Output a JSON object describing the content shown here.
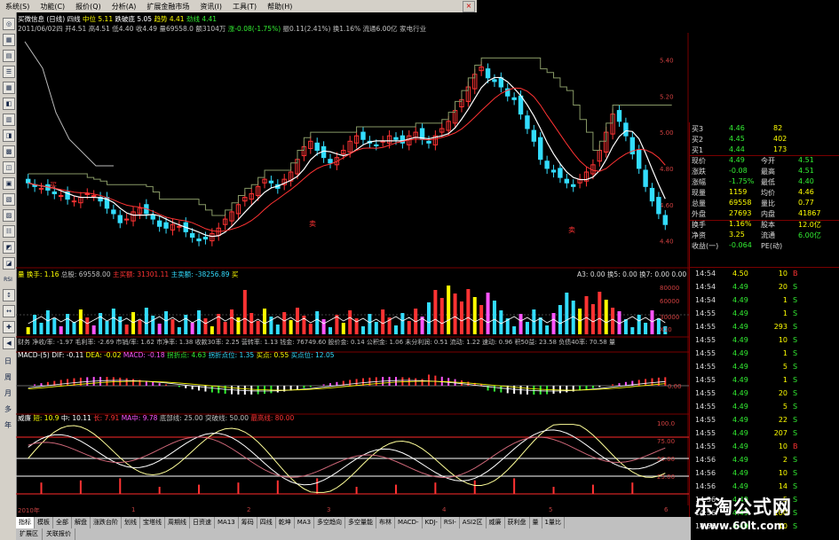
{
  "menu": [
    "系统(S)",
    "功能(C)",
    "报价(Q)",
    "分析(A)",
    "扩展金融市场",
    "资讯(I)",
    "工具(T)",
    "帮助(H)"
  ],
  "close_glyph": "×",
  "left_toolbar_chars": [
    "日",
    "周",
    "月",
    "多",
    "年"
  ],
  "left_toolbar_rsi": "RSI",
  "info1": {
    "a": "买微信息 (日线) 四线",
    "b": "中位 5.11",
    "c": "跌破底 5.05",
    "d": "趋势 4.41",
    "e": "劲线 4.41"
  },
  "info2": {
    "a": "2011/06/02四 开4.51 高4.51 低4.40 收4.49 量69558.0 额3104万",
    "b": "涨-0.08(-1.75%)",
    "c": "振0.11(2.41%) 换1.16% 流通6.00亿 家电行业"
  },
  "vol_info": {
    "a": "量 换手: 1.16",
    "b": "总股: 69558.00",
    "c": "主买额: 31301.11",
    "d": "主卖额: -38256.89",
    "e": "买",
    "f": "A3: 0.00 换5: 0.00 换7: 0.00 0.00"
  },
  "fin_info": "财务 净收/率: -1.97 毛利率: -2.69 市销/率: 1.62 市净率: 1.38 收款30率: 2.25 营转率: 1.13 钱金: 76749.60 股价金: 0.14 公积金: 1.06 未分利润: 0.51 流动: 1.22 速动: 0.96 积50益: 23.58 负债40率: 70.58 量",
  "macd_info": {
    "a": "MACD-(5)",
    "b": "DIF: -0.11",
    "c": "DEA: -0.02",
    "d": "MACD: -0.18",
    "e": "拐折点: 4.63",
    "f": "拐折点位: 1.35",
    "g": "买点: 0.55",
    "h": "买点位: 12.05"
  },
  "kdj_info": {
    "a": "威廉",
    "b": "短: 10.9",
    "c": "中: 10.11",
    "d": "长: 7.91",
    "e": "MA中: 9.78",
    "f": "底部线: 25.00",
    "g": "突破线: 50.00",
    "h": "最高线: 80.00"
  },
  "price_axis": [
    "5.40",
    "5.20",
    "5.00",
    "4.80",
    "4.60",
    "4.40"
  ],
  "vol_axis": [
    "80000",
    "60000",
    "30000",
    "X10"
  ],
  "macd_axis": [
    "0.00"
  ],
  "kdj_axis": [
    "100.0",
    "75.00",
    "50.00",
    "25.00"
  ],
  "quote": [
    {
      "l": "买3",
      "v": "4.46",
      "n": "82"
    },
    {
      "l": "买2",
      "v": "4.45",
      "n": "402"
    },
    {
      "l": "买1",
      "v": "4.44",
      "n": "173"
    },
    {
      "l": "现价",
      "v": "4.49",
      "l2": "今开",
      "v2": "4.51"
    },
    {
      "l": "涨跌",
      "v": "-0.08",
      "l2": "最高",
      "v2": "4.51"
    },
    {
      "l": "涨幅",
      "v": "-1.75%",
      "l2": "最低",
      "v2": "4.40"
    },
    {
      "l": "现量",
      "v": "1159",
      "l2": "均价",
      "v2": "4.46"
    },
    {
      "l": "总量",
      "v": "69558",
      "l2": "量比",
      "v2": "0.77"
    },
    {
      "l": "外盘",
      "v": "27693",
      "l2": "内盘",
      "v2": "41867"
    },
    {
      "l": "换手",
      "v": "1.16%",
      "l2": "股本",
      "v2": "12.0亿"
    },
    {
      "l": "净资",
      "v": "3.25",
      "l2": "流通",
      "v2": "6.00亿"
    },
    {
      "l": "收益(一)",
      "v": "-0.064",
      "l2": "PE(动)",
      "v2": ""
    }
  ],
  "ticks": [
    {
      "t": "14:54",
      "p": "4.50",
      "v": "10",
      "s": "B"
    },
    {
      "t": "14:54",
      "p": "4.49",
      "v": "20",
      "s": "S"
    },
    {
      "t": "14:54",
      "p": "4.49",
      "v": "1",
      "s": "S"
    },
    {
      "t": "14:55",
      "p": "4.49",
      "v": "1",
      "s": "S"
    },
    {
      "t": "14:55",
      "p": "4.49",
      "v": "293",
      "s": "S"
    },
    {
      "t": "14:55",
      "p": "4.49",
      "v": "10",
      "s": "S"
    },
    {
      "t": "14:55",
      "p": "4.49",
      "v": "1",
      "s": "S"
    },
    {
      "t": "14:55",
      "p": "4.49",
      "v": "5",
      "s": "S"
    },
    {
      "t": "14:55",
      "p": "4.49",
      "v": "1",
      "s": "S"
    },
    {
      "t": "14:55",
      "p": "4.49",
      "v": "20",
      "s": "S"
    },
    {
      "t": "14:55",
      "p": "4.49",
      "v": "5",
      "s": "S"
    },
    {
      "t": "14:55",
      "p": "4.49",
      "v": "22",
      "s": "S"
    },
    {
      "t": "14:55",
      "p": "4.49",
      "v": "207",
      "s": "S"
    },
    {
      "t": "14:55",
      "p": "4.49",
      "v": "10",
      "s": "B"
    },
    {
      "t": "14:56",
      "p": "4.49",
      "v": "2",
      "s": "S"
    },
    {
      "t": "14:56",
      "p": "4.49",
      "v": "10",
      "s": "S"
    },
    {
      "t": "14:56",
      "p": "4.49",
      "v": "14",
      "s": "S"
    },
    {
      "t": "14:56",
      "p": "4.49",
      "v": "5",
      "s": "S"
    },
    {
      "t": "14:56",
      "p": "4.49",
      "v": "100",
      "s": "S"
    },
    {
      "t": "14:56",
      "p": "4.49",
      "v": "10",
      "s": "S"
    }
  ],
  "time_scale": [
    "2010年",
    "1",
    "2",
    "3",
    "4",
    "5",
    "6"
  ],
  "tabs": [
    "指标",
    "模板",
    "全部",
    "解盘",
    "涨跌台阶",
    "划线",
    "宝塔线",
    "周期线",
    "日资速",
    "MA13",
    "筹码",
    "四线",
    "乾坤",
    "MA3",
    "多空趋向",
    "多空量能",
    "布林",
    "MACD-",
    "KDJ-",
    "RSI-",
    "ASI2区",
    "威廉",
    "获利盘",
    "量",
    "1量比"
  ],
  "active_tab": 0,
  "subtabs": [
    "扩展区",
    "关联报价"
  ],
  "chart_labels": {
    "buy": "买",
    "sell": "卖",
    "sell2": "卖"
  },
  "watermark": {
    "title": "乐淘公式网",
    "url": "www.60lt.com"
  },
  "colors": {
    "up": "#ff3333",
    "down": "#33ddff",
    "ma1": "#ffffff",
    "ma2": "#ffff00",
    "ma3": "#33ee33",
    "magenta": "#ff55ff",
    "frame": "#7a0000"
  },
  "chart_data": {
    "type": "candlestick",
    "price": {
      "ylim": [
        4.3,
        5.5
      ],
      "closes": [
        4.72,
        4.7,
        4.69,
        4.68,
        4.66,
        4.65,
        4.63,
        4.62,
        4.64,
        4.66,
        4.65,
        4.62,
        4.58,
        4.55,
        4.5,
        4.52,
        4.56,
        4.58,
        4.55,
        4.52,
        4.48,
        4.47,
        4.49,
        4.48,
        4.45,
        4.42,
        4.4,
        4.41,
        4.44,
        4.47,
        4.52,
        4.56,
        4.6,
        4.64,
        4.66,
        4.7,
        4.74,
        4.72,
        4.69,
        4.74,
        4.78,
        4.85,
        4.92,
        4.95,
        4.9,
        4.86,
        4.83,
        4.86,
        4.9,
        4.95,
        4.98,
        4.96,
        4.94,
        4.93,
        4.95,
        4.98,
        4.96,
        4.94,
        4.98,
        5.0,
        4.96,
        4.94,
        4.98,
        5.02,
        5.06,
        5.12,
        5.18,
        5.25,
        5.32,
        5.36,
        5.3,
        5.28,
        5.25,
        5.2,
        5.18,
        5.1,
        5.02,
        4.95,
        4.85,
        4.8,
        4.78,
        4.75,
        4.72,
        4.7,
        4.74,
        4.78,
        4.82,
        4.9,
        5.0,
        5.1,
        5.06,
        4.98,
        4.88,
        4.8,
        4.7,
        4.62,
        4.55,
        4.49
      ]
    },
    "kdj": {
      "ylim": [
        0,
        100
      ],
      "levels": [
        25,
        50,
        80
      ]
    }
  }
}
